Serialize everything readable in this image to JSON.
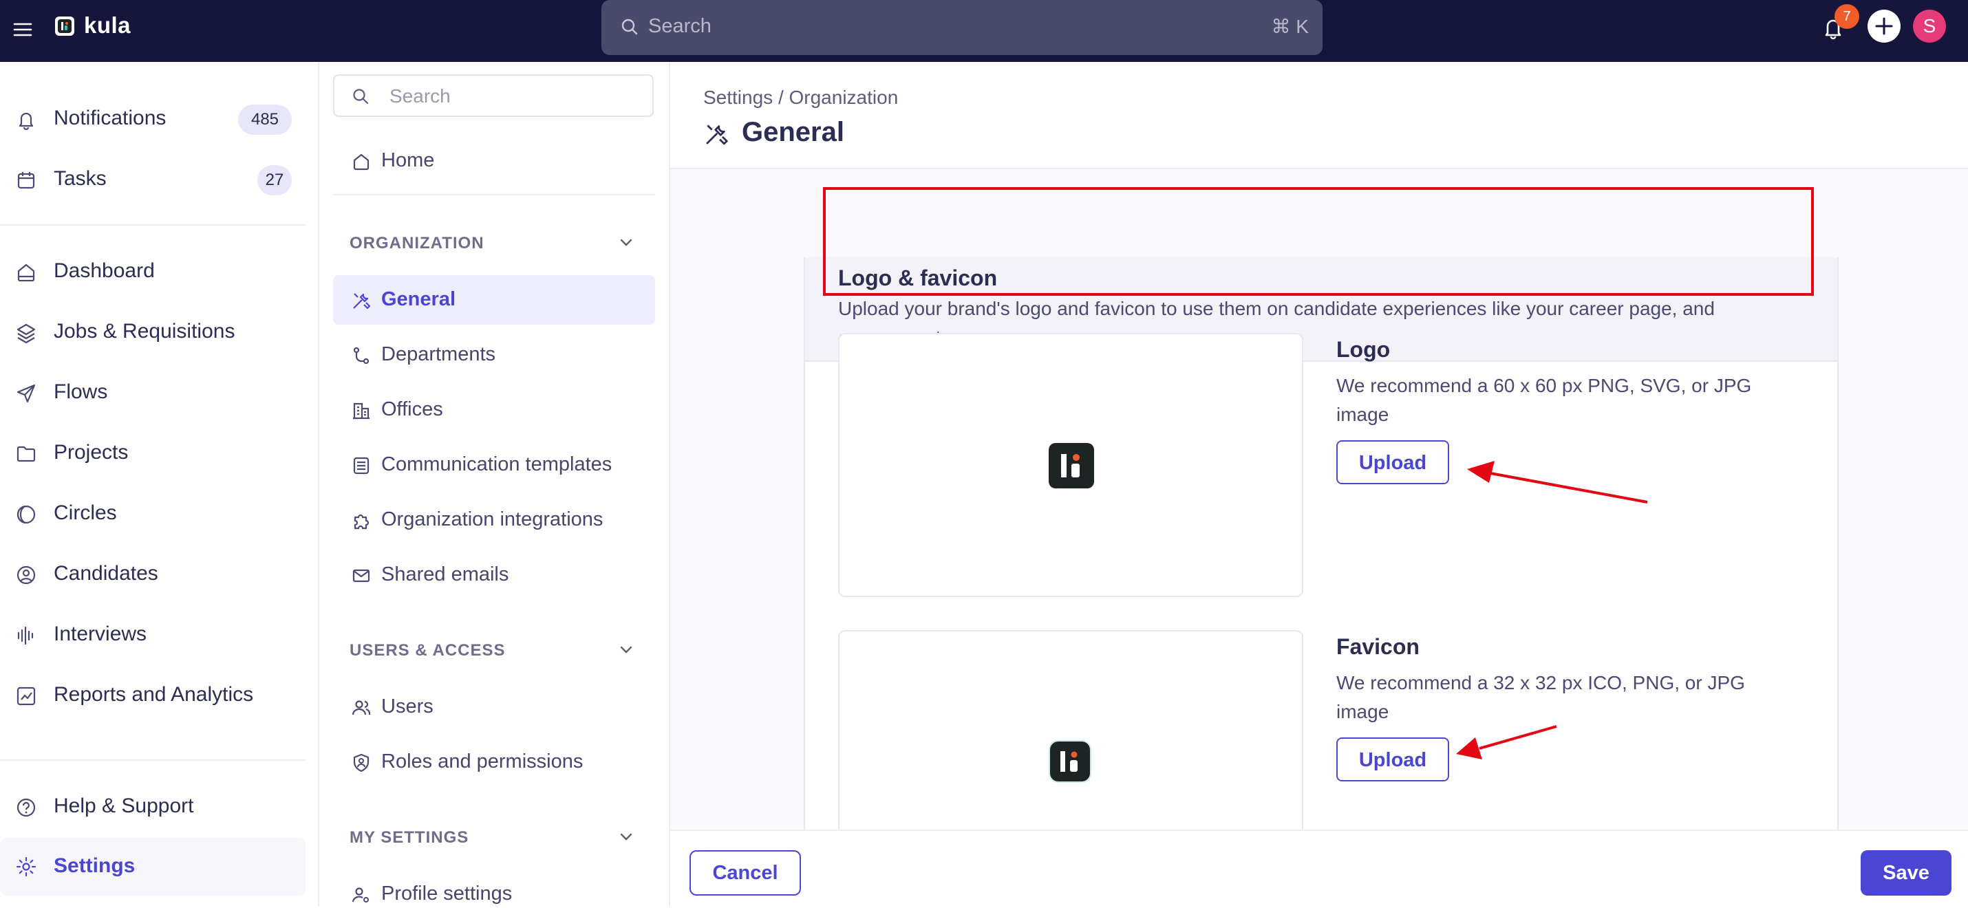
{
  "app": {
    "brand": "kula",
    "search_placeholder": "Search",
    "search_shortcut": "⌘ K",
    "notification_count": "7",
    "avatar_initial": "S"
  },
  "colors": {
    "topbar": "#16163d",
    "accent": "#4b45d6",
    "badge": "#f25c2a",
    "avatar": "#e63b78",
    "highlight": "#e30613"
  },
  "leftnav": {
    "notifications": {
      "label": "Notifications",
      "count": "485",
      "icon": "bell-icon"
    },
    "tasks": {
      "label": "Tasks",
      "count": "27",
      "icon": "calendar-check-icon"
    },
    "items": [
      {
        "label": "Dashboard",
        "icon": "home-icon"
      },
      {
        "label": "Jobs & Requisitions",
        "icon": "layers-icon"
      },
      {
        "label": "Flows",
        "icon": "send-icon"
      },
      {
        "label": "Projects",
        "icon": "folder-icon"
      },
      {
        "label": "Circles",
        "icon": "circles-icon"
      },
      {
        "label": "Candidates",
        "icon": "user-circle-icon"
      },
      {
        "label": "Interviews",
        "icon": "audio-wave-icon"
      },
      {
        "label": "Reports and Analytics",
        "icon": "chart-icon"
      }
    ],
    "help": {
      "label": "Help & Support",
      "icon": "help-icon"
    },
    "settings": {
      "label": "Settings",
      "icon": "gear-icon"
    }
  },
  "subnav": {
    "search_placeholder": "Search",
    "home": "Home",
    "organization_section": "ORGANIZATION",
    "organization_items": [
      "General",
      "Departments",
      "Offices",
      "Communication templates",
      "Organization integrations",
      "Shared emails"
    ],
    "users_section": "USERS & ACCESS",
    "users_items": [
      "Users",
      "Roles and permissions"
    ],
    "my_settings_section": "MY SETTINGS",
    "my_settings_items": [
      "Profile settings"
    ]
  },
  "main": {
    "breadcrumb": "Settings / Organization",
    "title": "General",
    "section": {
      "title": "Logo & favicon",
      "description": "Upload your brand's logo and favicon to use them on candidate experiences like your career page, and assessments"
    },
    "logo": {
      "title": "Logo",
      "description": "We recommend a 60 x 60 px PNG, SVG, or JPG image",
      "button": "Upload"
    },
    "favicon": {
      "title": "Favicon",
      "description": "We recommend a 32 x 32 px ICO, PNG, or JPG image",
      "button": "Upload"
    }
  },
  "footer": {
    "cancel": "Cancel",
    "save": "Save"
  }
}
